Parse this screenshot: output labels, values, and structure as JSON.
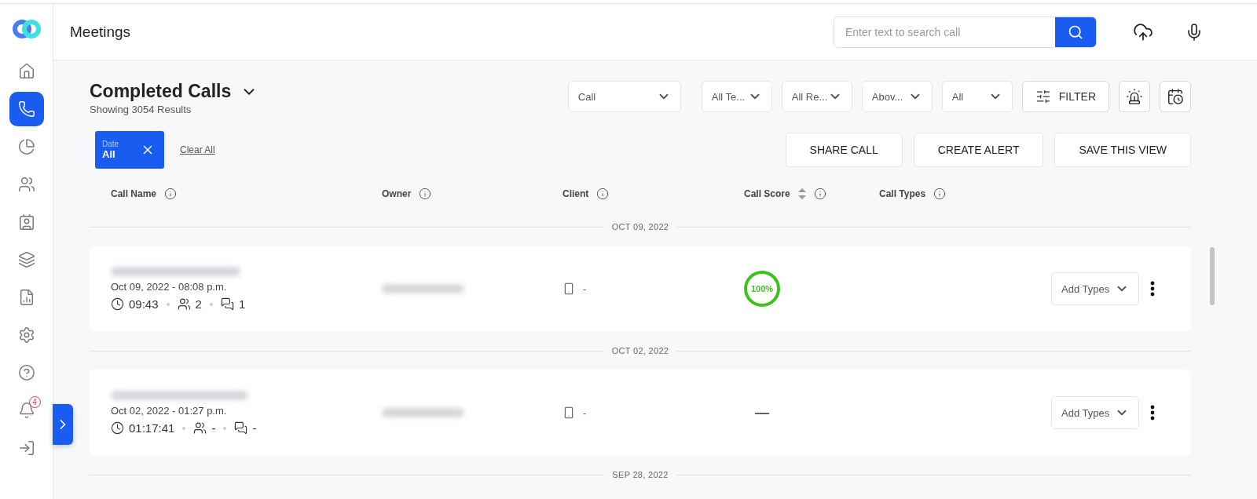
{
  "sidebar": {
    "items": [
      {
        "kind": "home",
        "selected": false
      },
      {
        "kind": "calls",
        "selected": true
      },
      {
        "kind": "analytics",
        "selected": false
      },
      {
        "kind": "team",
        "selected": false
      },
      {
        "kind": "contacts",
        "selected": false
      },
      {
        "kind": "layers",
        "selected": false
      },
      {
        "kind": "reports",
        "selected": false
      },
      {
        "kind": "settings",
        "selected": false
      },
      {
        "kind": "help",
        "selected": false
      },
      {
        "kind": "notifications",
        "selected": false,
        "badge": "4"
      },
      {
        "kind": "logout",
        "selected": false
      }
    ]
  },
  "header": {
    "title": "Meetings",
    "search": {
      "placeholder": "Enter text to search call"
    }
  },
  "page": {
    "title": "Completed Calls",
    "subtitle": "Showing 3054 Results"
  },
  "filters": [
    "Call",
    "All Te...",
    "All Re...",
    "Abov...",
    "All"
  ],
  "filter_button": "FILTER",
  "chips": [
    {
      "label": "Date",
      "value": "All"
    }
  ],
  "clear_all": "Clear All",
  "actions": [
    "SHARE CALL",
    "CREATE ALERT",
    "SAVE THIS VIEW"
  ],
  "table": {
    "columns": [
      {
        "label": "Call Name",
        "kind": "plain"
      },
      {
        "label": "Owner",
        "kind": "plain"
      },
      {
        "label": "Client",
        "kind": "plain"
      },
      {
        "label": "Call Score",
        "kind": "sortable"
      },
      {
        "label": "Call Types",
        "kind": "plain"
      }
    ],
    "groups": [
      {
        "date": "OCT 09, 2022",
        "rows": [
          {
            "datetime": "Oct 09, 2022 - 08:08 p.m.",
            "duration": "09:43",
            "participants": "2",
            "comments": "1",
            "client": "-",
            "score": "100%",
            "kind": "ring",
            "types": "Add Types"
          }
        ]
      },
      {
        "date": "OCT 02, 2022",
        "rows": [
          {
            "datetime": "Oct 02, 2022 - 01:27 p.m.",
            "duration": "01:17:41",
            "participants": "-",
            "comments": "-",
            "client": "-",
            "score": "—",
            "kind": "dash",
            "types": "Add Types"
          }
        ]
      },
      {
        "date": "SEP 28, 2022"
      }
    ]
  }
}
